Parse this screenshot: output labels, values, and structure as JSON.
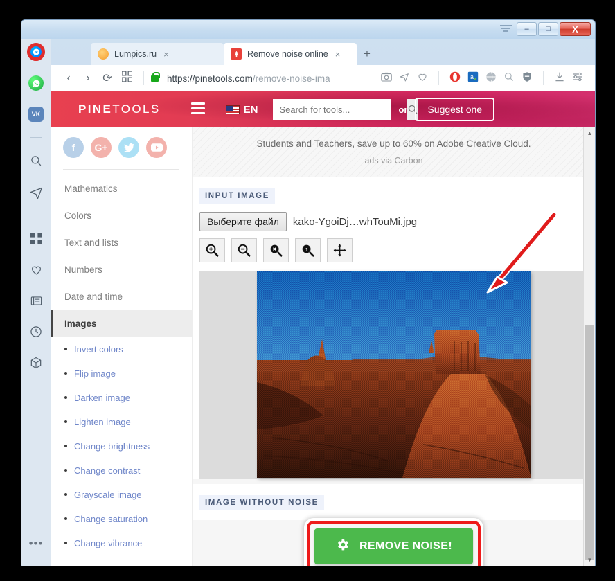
{
  "browser": {
    "app": "Opera",
    "tabs": [
      {
        "title": "Lumpics.ru",
        "favicon": "orange-circle-icon",
        "active": false
      },
      {
        "title": "Remove noise online",
        "favicon": "pine-tree-icon",
        "active": true
      }
    ],
    "new_tab_label": "+",
    "close_label": "×",
    "nav": {
      "back": "‹",
      "forward": "›",
      "reload": "⟳",
      "speeddial": "speed-dial-icon"
    },
    "address": {
      "secure": true,
      "url_host": "https://pinetools.com",
      "url_path": "/remove-noise-ima"
    },
    "toolbar_icons": [
      "snapshot-icon",
      "send-icon",
      "heart-icon",
      "opera-icon",
      "amazon-assistant-icon",
      "globe-icon",
      "search-popup-icon",
      "adblock-shield-icon",
      "downloads-icon",
      "easy-setup-icon"
    ],
    "window_controls": {
      "minimize": "–",
      "maximize": "□",
      "close": "X"
    },
    "sidebar_icons": [
      "messenger-icon",
      "whatsapp-icon",
      "vk-icon",
      "search-icon",
      "telegram-icon",
      "grid-icon",
      "heart-icon",
      "news-icon",
      "history-clock-icon",
      "extensions-cube-icon",
      "more-options-icon"
    ],
    "vk_label": "VK",
    "more_label": "•••"
  },
  "site": {
    "logo_bold": "PINE",
    "logo_light": "TOOLS",
    "menu_icon": "hamburger-menu-icon",
    "language": "EN",
    "flag": "us-flag-icon",
    "search_placeholder": "Search for tools...",
    "search_value": "",
    "search_icon": "search-icon",
    "or_label": "or",
    "suggest_label": "Suggest one",
    "accent_color": "#e03a55",
    "ad": {
      "line1": "Students and Teachers, save up to 60% on Adobe Creative Cloud.",
      "line2": "ads via Carbon"
    }
  },
  "sidebar": {
    "socials": [
      {
        "name": "facebook-icon",
        "glyph": "f"
      },
      {
        "name": "googleplus-icon",
        "glyph": "G+"
      },
      {
        "name": "twitter-icon",
        "glyph": "ᵛ"
      },
      {
        "name": "youtube-icon",
        "glyph": "▶"
      }
    ],
    "categories": [
      {
        "label": "Mathematics",
        "active": false
      },
      {
        "label": "Colors",
        "active": false
      },
      {
        "label": "Text and lists",
        "active": false
      },
      {
        "label": "Numbers",
        "active": false
      },
      {
        "label": "Date and time",
        "active": false
      },
      {
        "label": "Images",
        "active": true
      }
    ],
    "image_tools": [
      "Invert colors",
      "Flip image",
      "Darken image",
      "Lighten image",
      "Change brightness",
      "Change contrast",
      "Grayscale image",
      "Change saturation",
      "Change vibrance"
    ]
  },
  "main": {
    "input_label": "INPUT IMAGE",
    "file_button": "Выберите файл",
    "file_name": "kako-YgoiDj…whTouMi.jpg",
    "zoom_buttons": [
      {
        "name": "zoom-in-button",
        "glyph": "+"
      },
      {
        "name": "zoom-out-button",
        "glyph": "−"
      },
      {
        "name": "zoom-reset-button",
        "glyph": "×"
      },
      {
        "name": "zoom-actual-size-button",
        "glyph": "1"
      },
      {
        "name": "pan-move-button",
        "glyph": "✥"
      }
    ],
    "preview_alt": "noisy desert mesa photograph",
    "output_label": "IMAGE WITHOUT NOISE",
    "action_button": "REMOVE NOISE!",
    "action_icon": "gear-icon",
    "action_color": "#4cb94c"
  },
  "annotations": {
    "arrow": {
      "name": "red-arrow-pointer",
      "color": "#e01b1b"
    },
    "highlight": {
      "name": "red-highlight-box",
      "color": "#ee1b1b"
    }
  }
}
